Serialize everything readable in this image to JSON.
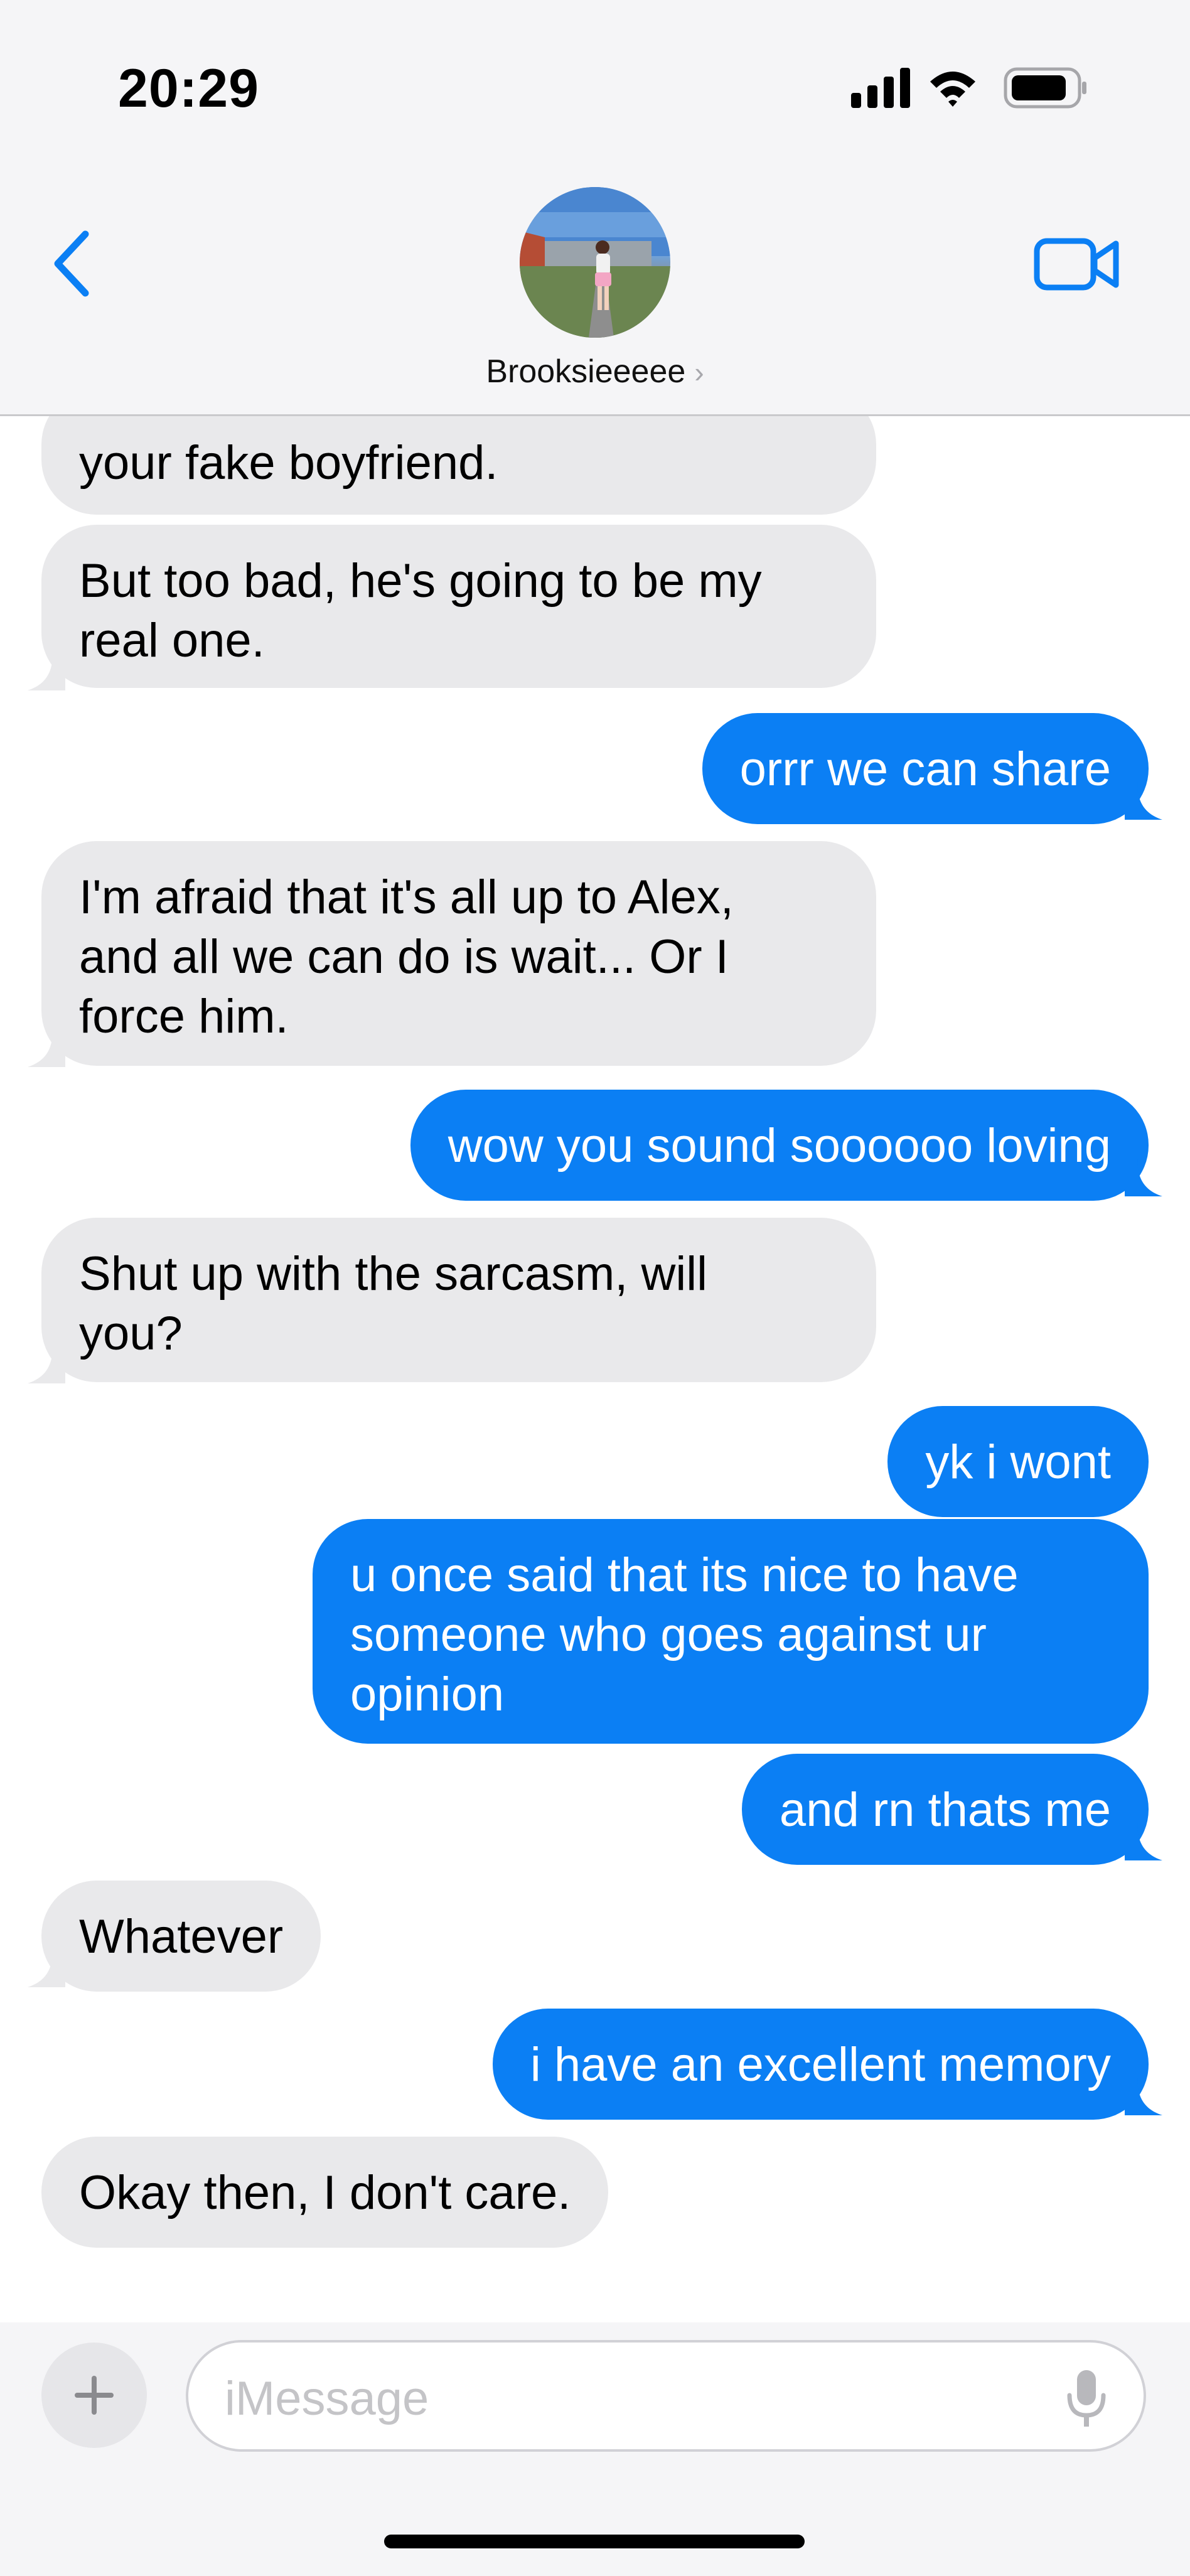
{
  "status_bar": {
    "time": "20:29",
    "icons": [
      "cellular-signal-icon",
      "wifi-icon",
      "battery-icon"
    ]
  },
  "header": {
    "contact_name": "Brooksieeeee",
    "back_icon": "chevron-left-icon",
    "video_icon": "video-camera-icon",
    "accent_color": "#0b7ff4"
  },
  "messages": [
    {
      "from": "them",
      "text": "your fake boyfriend."
    },
    {
      "from": "them",
      "text": "But too bad, he's going to be my\nreal one."
    },
    {
      "from": "me",
      "text": "orrr we can share"
    },
    {
      "from": "them",
      "text": "I'm afraid that it's all up to Alex,\nand all we can do is wait... Or I\nforce him."
    },
    {
      "from": "me",
      "text": "wow you sound soooooo loving"
    },
    {
      "from": "them",
      "text": "Shut up with the sarcasm, will\nyou?"
    },
    {
      "from": "me",
      "text": "yk i wont"
    },
    {
      "from": "me",
      "text": "u once said that its nice to have\nsomeone who goes against ur\nopinion"
    },
    {
      "from": "me",
      "text": "and rn thats me"
    },
    {
      "from": "them",
      "text": "Whatever"
    },
    {
      "from": "me",
      "text": "i have an excellent memory"
    },
    {
      "from": "them",
      "text": "Okay then, I don't care."
    }
  ],
  "compose": {
    "placeholder": "iMessage",
    "plus_icon": "plus-icon",
    "mic_icon": "microphone-icon"
  },
  "colors": {
    "incoming_bubble": "#e9e9eb",
    "outgoing_bubble": "#0b7ff4"
  }
}
